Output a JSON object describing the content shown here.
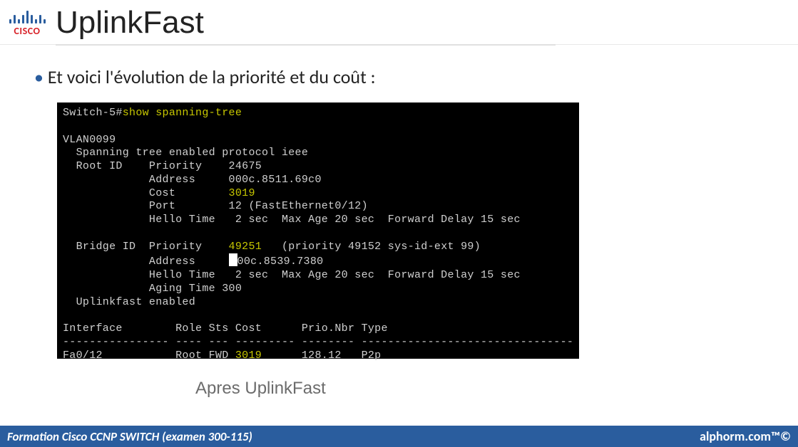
{
  "logo": {
    "brand": "CISCO"
  },
  "title": "UplinkFast",
  "bullet": "Et voici l'évolution de la priorité et du coût :",
  "terminal": {
    "prompt": "Switch-5#",
    "command": "show spanning-tree",
    "vlan": "VLAN0099",
    "l1": "  Spanning tree enabled protocol ieee",
    "root_label": "  Root ID    Priority    ",
    "root_prio": "24675",
    "root_addr": "             Address     000c.8511.69c0",
    "root_cost_l": "             Cost        ",
    "root_cost_v": "3019",
    "root_port": "             Port        12 (FastEthernet0/12)",
    "root_hello": "             Hello Time   2 sec  Max Age 20 sec  Forward Delay 15 sec",
    "bridge_label": "  Bridge ID  Priority    ",
    "bridge_prio": "49251",
    "bridge_ext": "   (priority 49152 sys-id-ext 99)",
    "bridge_addr_l": "             Address     ",
    "bridge_addr_v": "00c.8539.7380",
    "bridge_hello": "             Hello Time   2 sec  Max Age 20 sec  Forward Delay 15 sec",
    "bridge_aging": "             Aging Time 300",
    "uplink": "  Uplinkfast enabled",
    "hdr": "Interface        Role Sts Cost      Prio.Nbr Type",
    "sep": "---------------- ---- --- --------- -------- --------------------------------",
    "row_a": "Fa0/12           Root FWD ",
    "row_cost": "3019",
    "row_b": "      128.12   P2p"
  },
  "caption": "Apres UplinkFast",
  "footer": {
    "left": "Formation Cisco CCNP SWITCH (examen 300-115)",
    "right": "alphorm.com™©"
  }
}
